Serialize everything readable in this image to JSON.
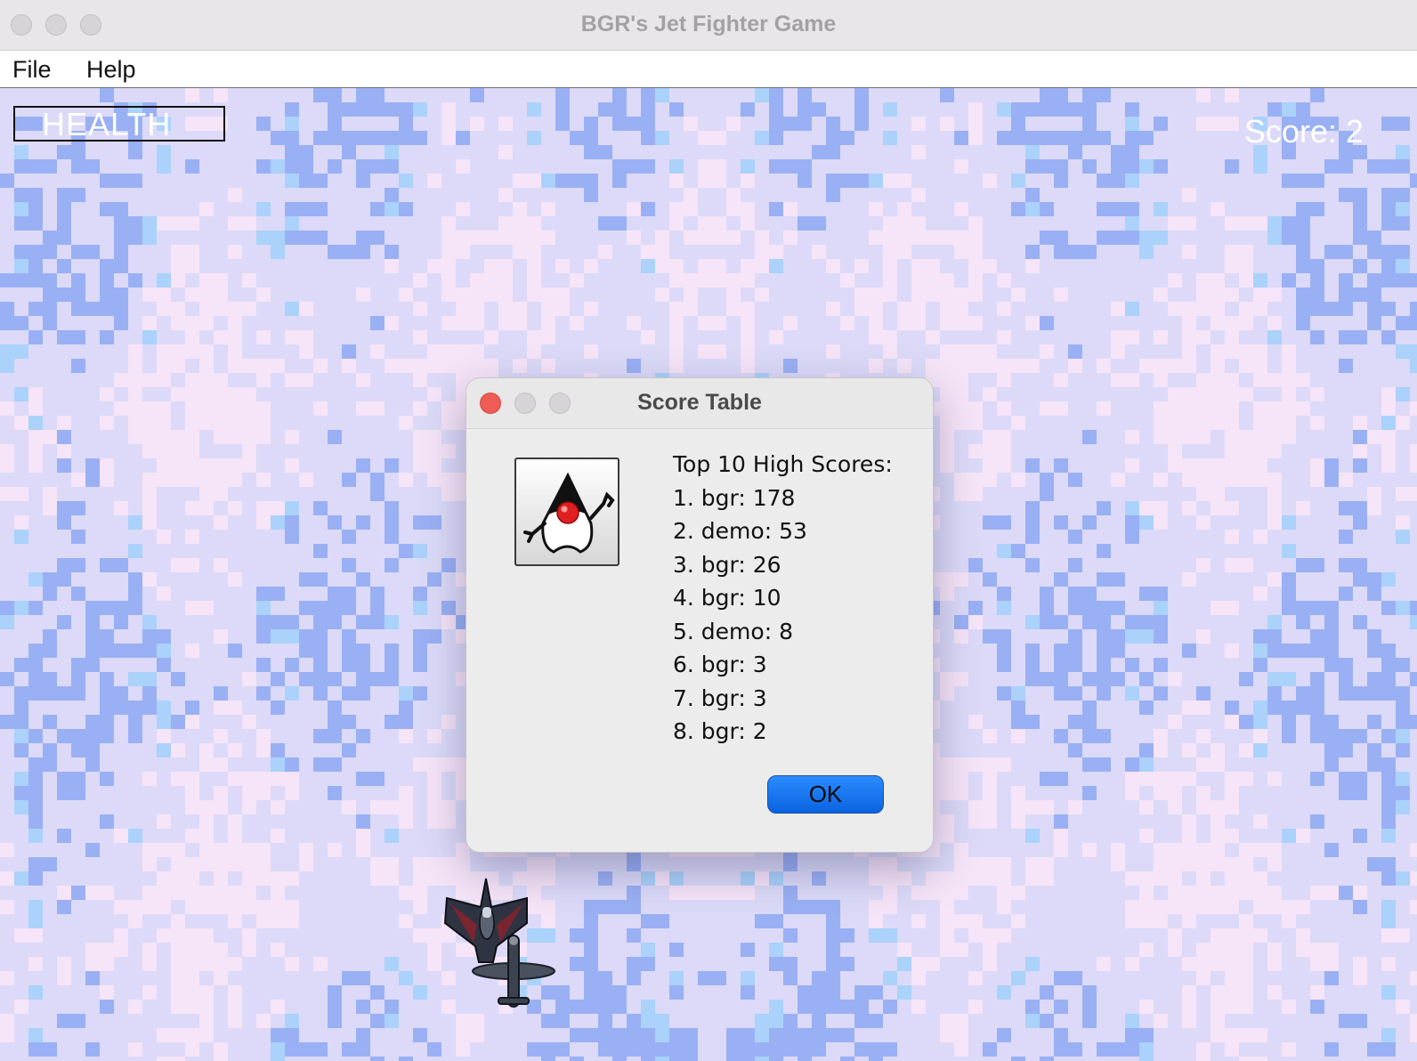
{
  "window": {
    "title": "BGR's Jet Fighter Game"
  },
  "menu": {
    "items": [
      "File",
      "Help"
    ]
  },
  "hud": {
    "health_label": "HEALTH",
    "score_text": "Score: 2"
  },
  "dialog": {
    "title": "Score Table",
    "heading": "Top 10 High Scores:",
    "scores": [
      "1. bgr: 178",
      "2. demo: 53",
      "3. bgr: 26",
      "4. bgr: 10",
      "5. demo: 8",
      "6. bgr: 3",
      "7. bgr: 3",
      "8. bgr: 2"
    ],
    "ok_label": "OK"
  },
  "colors": {
    "background_base": "#dcdaf8",
    "background_blue": "#9ab0f4",
    "background_pink": "#f6e4f8",
    "background_cyan": "#aad2fa",
    "ok_button": "#0a6cf0",
    "close_red": "#ee5c55"
  },
  "icons": [
    "duke-mascot-icon",
    "jet-fighter-sprite",
    "enemy-plane-sprite"
  ]
}
